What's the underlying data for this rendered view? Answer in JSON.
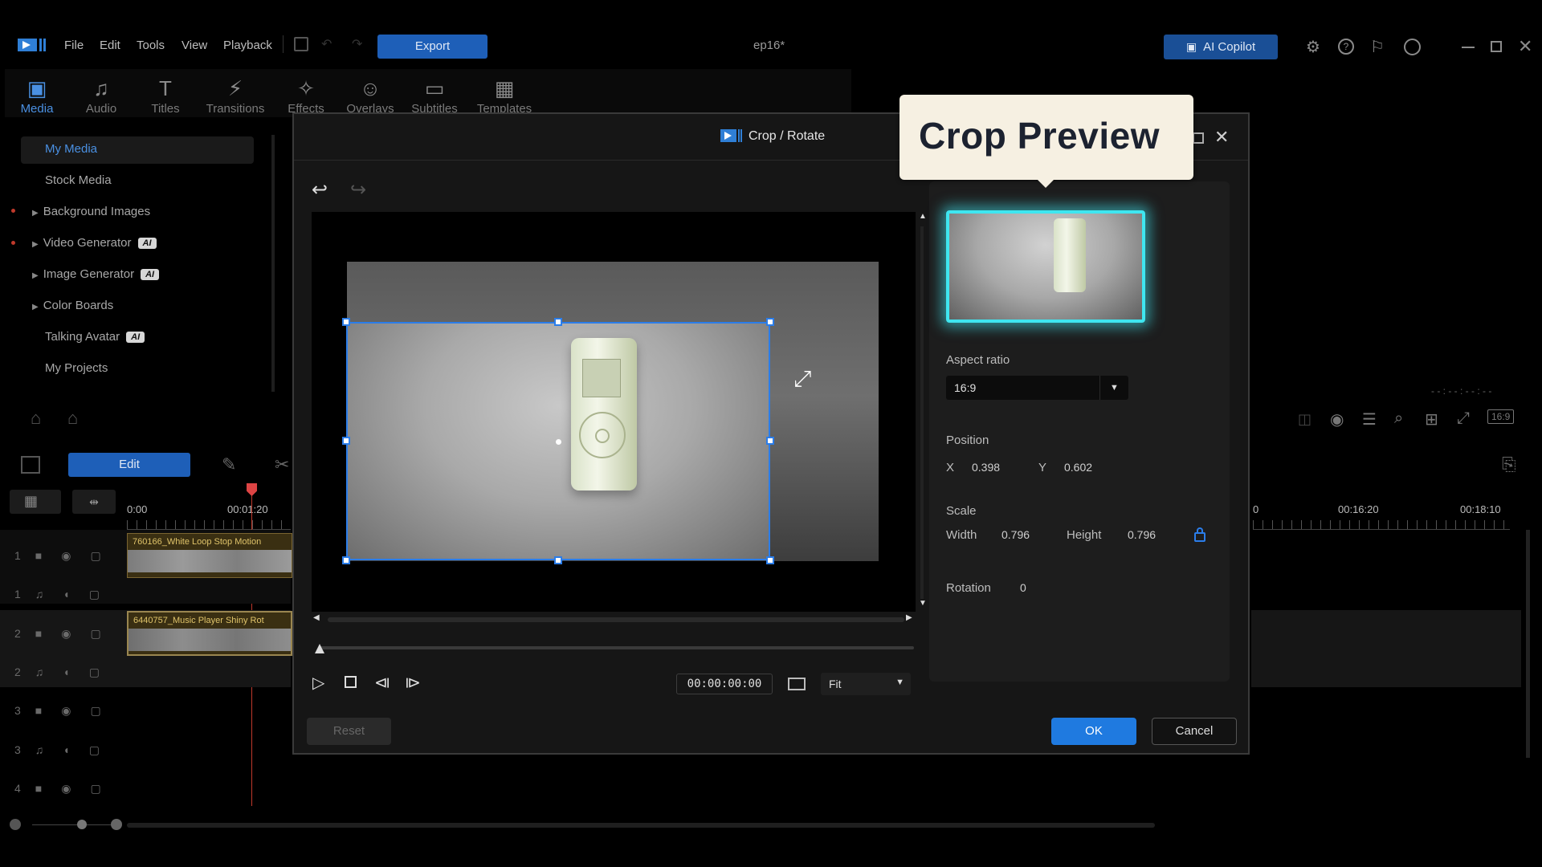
{
  "app": {
    "title": "ep16*",
    "menu": [
      "File",
      "Edit",
      "Tools",
      "View",
      "Playback"
    ],
    "export_label": "Export",
    "copilot_label": "AI Copilot"
  },
  "tabs": [
    {
      "label": "Media",
      "icon": "media-icon",
      "active": true
    },
    {
      "label": "Audio",
      "icon": "audio-icon"
    },
    {
      "label": "Titles",
      "icon": "titles-icon"
    },
    {
      "label": "Transitions",
      "icon": "transitions-icon"
    },
    {
      "label": "Effects",
      "icon": "effects-icon"
    },
    {
      "label": "Overlays",
      "icon": "overlays-icon"
    },
    {
      "label": "Subtitles",
      "icon": "subtitles-icon"
    },
    {
      "label": "Templates",
      "icon": "templates-icon"
    }
  ],
  "sidebar": {
    "items": [
      {
        "label": "My Media",
        "active": true
      },
      {
        "label": "Stock Media"
      },
      {
        "label": "Background Images",
        "expandable": true
      },
      {
        "label": "Video Generator",
        "expandable": true,
        "ai": true
      },
      {
        "label": "Image Generator",
        "expandable": true,
        "ai": true
      },
      {
        "label": "Color Boards",
        "expandable": true
      },
      {
        "label": "Talking Avatar",
        "ai": true
      },
      {
        "label": "My Projects"
      }
    ],
    "ai_badge": "AI"
  },
  "timeline": {
    "edit_label": "Edit",
    "time_start": "0:00",
    "time_mark": "00:01:20",
    "time_right_partial": "0",
    "time_right_1": "00:16:20",
    "time_right_2": "00:18:10",
    "timecode_dim": "- - : - - : - - : - -",
    "aspect_badge": "16:9",
    "clips": [
      {
        "label": "760166_White Loop Stop Motion"
      },
      {
        "label": "6440757_Music Player Shiny Rot"
      }
    ],
    "track_numbers": [
      "1",
      "1",
      "2",
      "2",
      "3",
      "3",
      "4"
    ]
  },
  "dialog": {
    "title": "Crop / Rotate",
    "preview_callout": "Crop Preview",
    "aspect_ratio_label": "Aspect ratio",
    "aspect_ratio_value": "16:9",
    "position_label": "Position",
    "x_label": "X",
    "x_value": "0.398",
    "y_label": "Y",
    "y_value": "0.602",
    "scale_label": "Scale",
    "width_label": "Width",
    "width_value": "0.796",
    "height_label": "Height",
    "height_value": "0.796",
    "rotation_label": "Rotation",
    "rotation_value": "0",
    "timecode": "00:00:00:00",
    "fit_value": "Fit",
    "reset_label": "Reset",
    "ok_label": "OK",
    "cancel_label": "Cancel"
  },
  "colors": {
    "accent": "#2b7de9",
    "glow": "#3fe6f0",
    "callout_bg": "#f6f0e2"
  }
}
